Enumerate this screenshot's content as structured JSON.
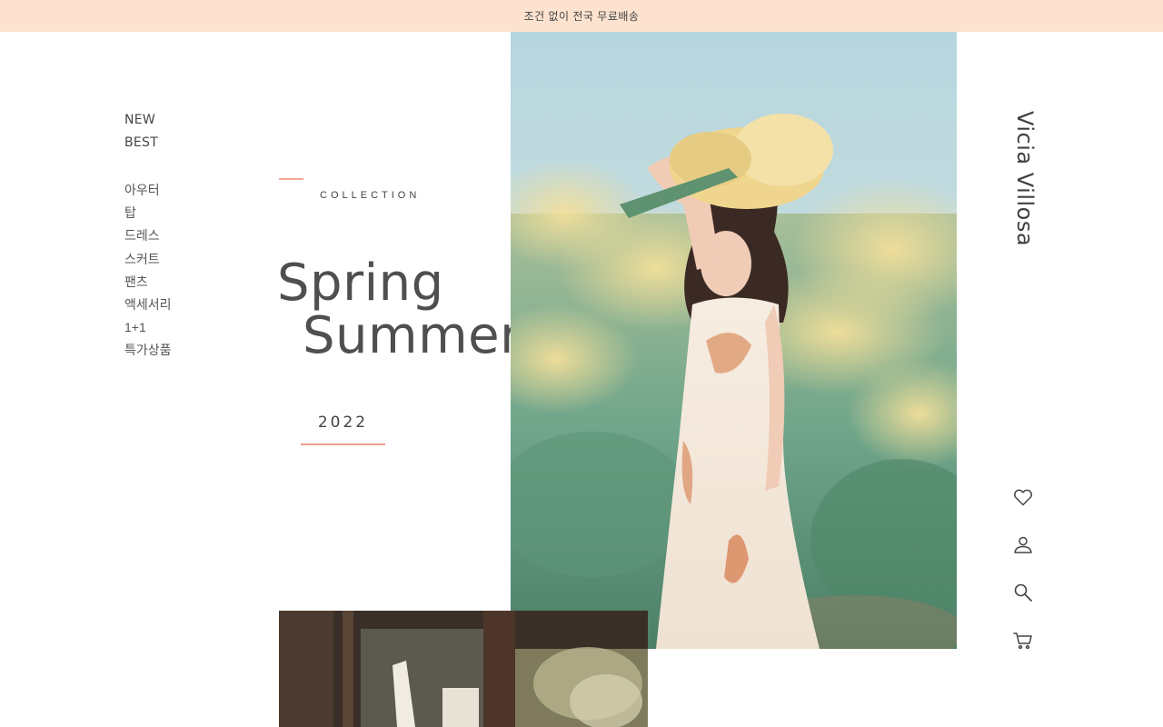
{
  "topbar": {
    "text": "조건 없이 전국 무료배송"
  },
  "nav": {
    "main": [
      "NEW",
      "BEST"
    ],
    "categories": [
      "아우터",
      "탑",
      "드레스",
      "스커트",
      "팬츠",
      "액세서리",
      "1+1",
      "특가상품"
    ]
  },
  "hero": {
    "collection_label": "COLLECTION",
    "title_line1": "Spring",
    "title_line2": "Summer",
    "year": "2022"
  },
  "brand": {
    "name": "Vicia Villosa"
  },
  "icons": [
    "heart-icon",
    "user-icon",
    "search-icon",
    "cart-icon"
  ],
  "colors": {
    "topbar_bg": "#fde3cf",
    "accent": "#ef9c86",
    "text": "#4f4f4f"
  }
}
